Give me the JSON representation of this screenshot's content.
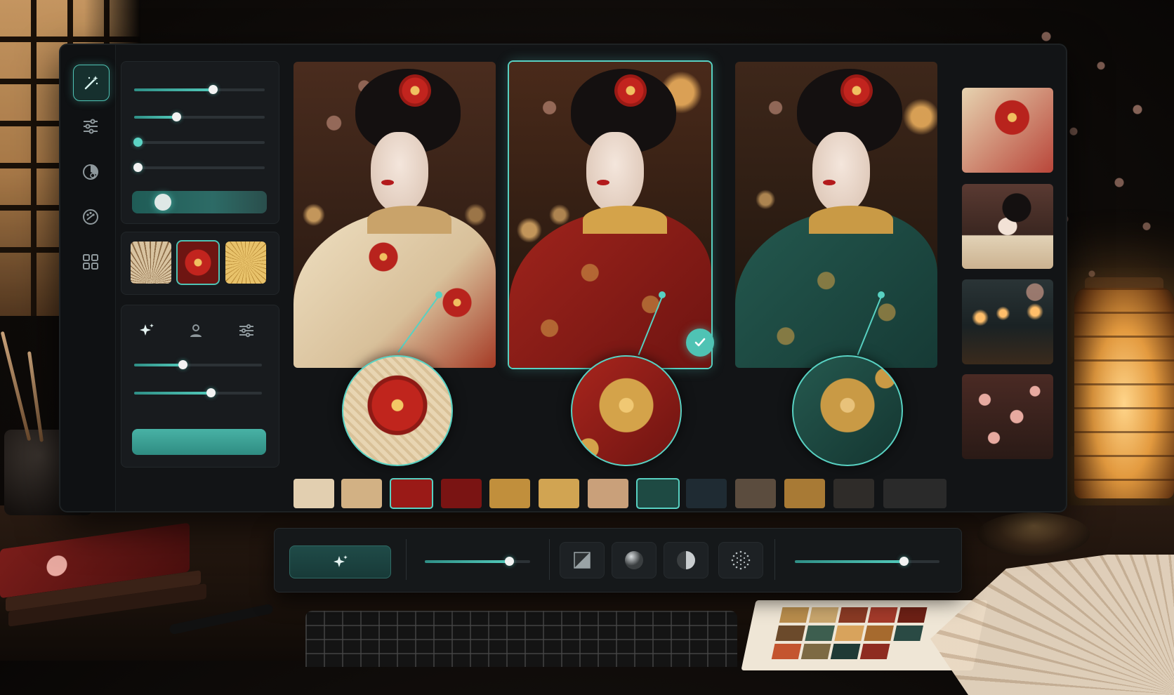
{
  "app": {
    "accent_color": "#4fc3b4",
    "panel_color": "#181b1e"
  },
  "rail": {
    "items": [
      {
        "icon": "magic-wand-icon",
        "active": true
      },
      {
        "icon": "sliders-icon",
        "active": false
      },
      {
        "icon": "color-wheel-icon",
        "active": false
      },
      {
        "icon": "palette-icon",
        "active": false
      },
      {
        "icon": "grid-icon",
        "active": false
      }
    ]
  },
  "adjust_panel": {
    "sliders": [
      0.6,
      0.32,
      0.0,
      0.0
    ],
    "toggle_on": true
  },
  "texture_thumbs": [
    {
      "icon": "fan-texture",
      "selected": false
    },
    {
      "icon": "red-floral-texture",
      "selected": true
    },
    {
      "icon": "gold-umbrella-texture",
      "selected": false
    }
  ],
  "mode_panel": {
    "modes": [
      "sparkle-icon",
      "person-icon",
      "sliders-icon"
    ],
    "sliders": [
      0.38,
      0.6
    ],
    "apply_button_label": ""
  },
  "variants": [
    {
      "name": "ivory-gold",
      "selected": false,
      "colors": {
        "kimono": "#e8d3b0",
        "accent": "#b8231d"
      }
    },
    {
      "name": "crimson-gold",
      "selected": true,
      "colors": {
        "kimono": "#8e1d18",
        "accent": "#d4a34a"
      }
    },
    {
      "name": "emerald-gold",
      "selected": false,
      "colors": {
        "kimono": "#1d4a44",
        "accent": "#c99a45"
      }
    }
  ],
  "side_thumbs": [
    {
      "icon": "fabric-detail"
    },
    {
      "icon": "portrait-profile"
    },
    {
      "icon": "lantern-canal"
    },
    {
      "icon": "cherry-blossom"
    }
  ],
  "palette": [
    {
      "color": "#e2cfb0",
      "selected": false
    },
    {
      "color": "#d2b184",
      "selected": false
    },
    {
      "color": "#9a1a17",
      "selected": true
    },
    {
      "color": "#7a1413",
      "selected": false
    },
    {
      "color": "#c18f3c",
      "selected": false
    },
    {
      "color": "#d1a452",
      "selected": false
    },
    {
      "color": "#c9a07a",
      "selected": false
    },
    {
      "color": "#1e4a43",
      "selected": true
    },
    {
      "color": "#1f2b33",
      "selected": false
    },
    {
      "color": "#5b4c3e",
      "selected": false
    },
    {
      "color": "#a87a35",
      "selected": false
    },
    {
      "color": "#2f2c29",
      "selected": false
    },
    {
      "color": "#2a2a2a",
      "selected": false
    }
  ],
  "toolbar": {
    "magic_button_icon": "sparkle-icon",
    "intensity": 0.8,
    "shape_buttons": [
      "square-mask-icon",
      "sphere-icon",
      "half-sphere-icon",
      "dots-circle-icon"
    ],
    "strength": 0.8
  }
}
